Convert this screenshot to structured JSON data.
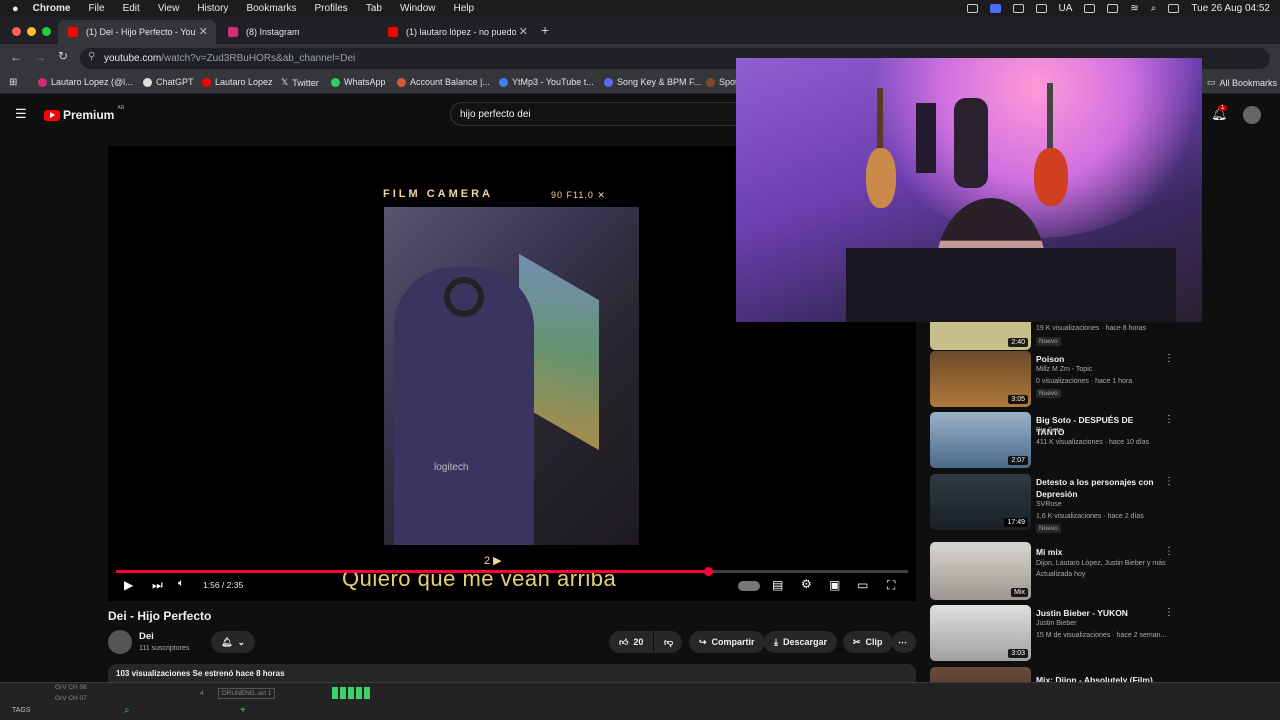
{
  "menubar": {
    "app": "Chrome",
    "items": [
      "File",
      "Edit",
      "View",
      "History",
      "Bookmarks",
      "Profiles",
      "Tab",
      "Window",
      "Help"
    ],
    "kb": "UA",
    "datetime": "Tue 26 Aug  04:52"
  },
  "tabs": [
    {
      "label": "(1) Dei - Hijo Perfecto - YouTu",
      "fav": "#ff0000"
    },
    {
      "label": "(8) Instagram",
      "fav": "#d62976"
    },
    {
      "label": "(1) lautaro lópez - no puedo c",
      "fav": "#ff0000"
    }
  ],
  "address": {
    "host": "youtube.com",
    "path": "/watch?v=Zud3RBuHORs&ab_channel=Dei"
  },
  "bookmarks": [
    "Lautaro Lopez (@l...",
    "ChatGPT",
    "Lautaro Lopez",
    "Twitter",
    "WhatsApp",
    "Account Balance |...",
    "YtMp3 - YouTube t...",
    "Song Key & BPM F...",
    "Spot"
  ],
  "all_bookmarks": "All Bookmarks",
  "yt": {
    "logo": "Premium",
    "region": "AR",
    "search_value": "hijo perfecto dei",
    "notif_count": "1"
  },
  "video": {
    "overlay_title": "FILM CAMERA",
    "overlay_info": "90 F11.0  ✕",
    "frame_marker": "2 ▶",
    "jersey_text": "logitech",
    "subtitle": "Quiero que me vean arriba",
    "time": "1:56 / 2:35",
    "progress": 0.748,
    "title": "Dei - Hijo Perfecto",
    "channel": "Dei",
    "subs": "111 suscriptores",
    "likes": "20",
    "share": "Compartir",
    "download": "Descargar",
    "clip": "Clip",
    "views_line": "103 visualizaciones  Se estrenó hace 8 horas"
  },
  "recs": [
    {
      "title": "",
      "channel": "",
      "meta": "19 K visualizaciones · hace 8 horas",
      "badge": "Nuevo",
      "dur": "2:40",
      "color": "#c7c08a"
    },
    {
      "title": "Poison",
      "channel": "Millz M Zm - Topic",
      "meta": "0 visualizaciones · hace 1 hora",
      "badge": "Nuevo",
      "dur": "3:05",
      "color": "#8a5a2a"
    },
    {
      "title": "Big Soto - DESPUÉS DE TANTO",
      "channel": "Big Soto",
      "meta": "411 K visualizaciones · hace 10 días",
      "badge": "",
      "dur": "2:07",
      "color": "#6f8fb0"
    },
    {
      "title": "Detesto a los personajes con Depresión",
      "channel": "SVRose",
      "meta": "1,6 K visualizaciones · hace 2 días",
      "badge": "Nuevo",
      "dur": "17:49",
      "color": "#2f3a44"
    },
    {
      "title": "Mi mix",
      "channel": "Dijon, Lautaro López, Justin Bieber y más",
      "meta": "Actualizada hoy",
      "badge": "",
      "dur": "Mix",
      "color": "#b9b6b0"
    },
    {
      "title": "Justin Bieber - YUKON",
      "channel": "Justin Bieber",
      "meta": "15 M de visualizaciones · hace 2 seman...",
      "badge": "",
      "dur": "3:03",
      "color": "#cfcfcf"
    },
    {
      "title": "Mix: Dijon - Absolutely (Film)",
      "channel": "",
      "meta": "",
      "badge": "",
      "dur": "",
      "color": "#6a4a3a"
    }
  ],
  "daw": {
    "tags": "TAGS",
    "track1": "GrV CH 08",
    "track2": "GrV CH 07",
    "num": "4",
    "clip": "DRUNENG..ert 1"
  }
}
